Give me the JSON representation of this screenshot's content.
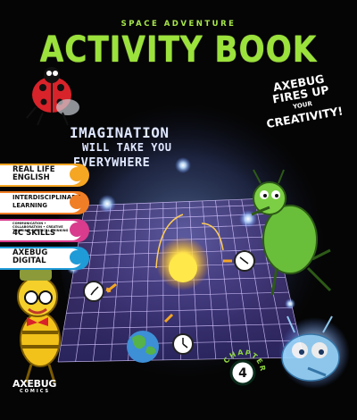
{
  "cover": {
    "series_label": "SPACE ADVENTURE",
    "title": "ACTIVITY BOOK",
    "tagline": {
      "line1": "AXEBUG",
      "line2": "FIRES UP",
      "line3": "YOUR",
      "line4": "CREATIVITY!"
    },
    "slogan": {
      "line1": "IMAGINATION",
      "line2": "WILL TAKE YOU",
      "line3": "EVERYWHERE"
    }
  },
  "features": [
    {
      "label": "REAL LIFE ENGLISH",
      "color": "#f5a623",
      "icon": "speech-icon"
    },
    {
      "label": "INTERDISCIPLINARY LEARNING",
      "color": "#f07e26",
      "icon": "book-icon"
    },
    {
      "label": "4C SKILLS",
      "sublabel": "COMMUNICATION • COLLABORATION • CREATIVE THINKING • CRITICAL THINKING",
      "color": "#d93b8d",
      "icon": "puzzle-icon"
    },
    {
      "label": "AXEBUG DIGITAL",
      "color": "#1f9bd7",
      "icon": "screen-icon"
    }
  ],
  "chapter": {
    "label": "CHAPTER",
    "number": "4"
  },
  "publisher": {
    "name": "AXEBUG",
    "sub": "COMICS"
  },
  "colors": {
    "title": "#9be23c",
    "background": "#050505",
    "grid": "#c9a6ff"
  }
}
